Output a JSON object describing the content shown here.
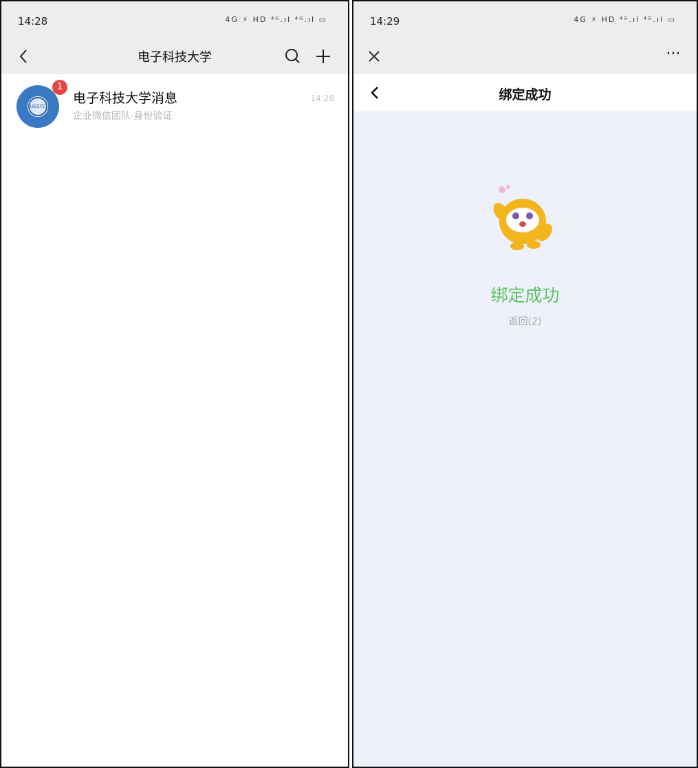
{
  "left": {
    "status": {
      "time": "14:28",
      "indicators": "4G ⚡ HD ⁴ᴳ.ıl ⁴ᴳ.ıl ▭"
    },
    "nav": {
      "title": "电子科技大学"
    },
    "messages": [
      {
        "title": "电子科技大学消息",
        "subtitle": "企业微信团队·身份验证",
        "time": "14:28",
        "badge": "1",
        "avatar_icon": "university-logo-icon"
      }
    ]
  },
  "right": {
    "status": {
      "time": "14:29",
      "indicators": "4G ⚡ HD ⁴ᴳ.ıl ⁴ᴳ.ıl ▭"
    },
    "topbar": {
      "more_label": "···"
    },
    "page": {
      "title": "绑定成功",
      "success_text": "绑定成功",
      "return_text": "返回(2)"
    }
  },
  "colors": {
    "success": "#5ec45e",
    "badge": "#e94545",
    "page_bg": "#eef1fb",
    "bar_bg": "#ededed"
  }
}
